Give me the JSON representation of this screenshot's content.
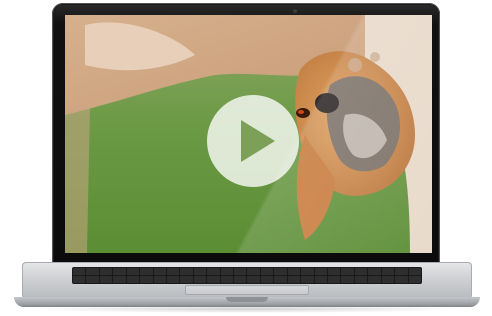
{
  "video": {
    "thumbnail_icon": "dog-photo",
    "play_icon": "play-icon",
    "state": "paused"
  },
  "device": {
    "icon": "laptop-icon"
  },
  "colors": {
    "background": "#ffffff",
    "play_button_fill": "#ffffff",
    "play_icon": "#7ca058",
    "bezel": "#111111",
    "aluminum": "#cfd1d4"
  }
}
